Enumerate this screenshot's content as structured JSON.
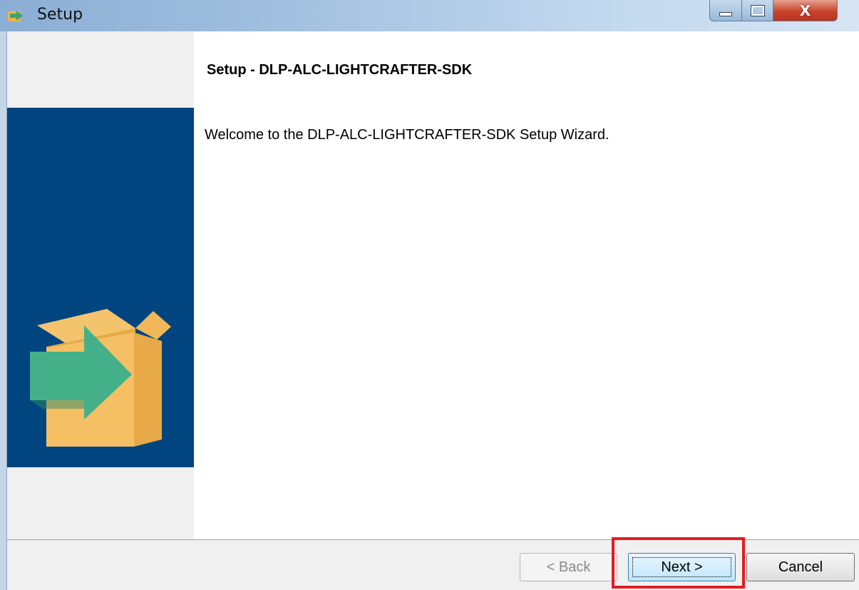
{
  "window": {
    "title": "Setup",
    "controls": {
      "minimize": "minimize",
      "maximize": "maximize",
      "close": "X"
    }
  },
  "content": {
    "heading": "Setup - DLP-ALC-LIGHTCRAFTER-SDK",
    "welcome": "Welcome to the DLP-ALC-LIGHTCRAFTER-SDK  Setup Wizard."
  },
  "buttons": {
    "back_label": "< Back",
    "next_label": "Next >",
    "cancel_label": "Cancel",
    "back_enabled": false
  },
  "icons": {
    "title": "setup-app-icon",
    "side_graphic": "box-with-arrow-icon"
  },
  "colors": {
    "side_band": "#004580",
    "box": "#f5c063",
    "arrow": "#44b08a",
    "highlight": "#e31b23"
  }
}
